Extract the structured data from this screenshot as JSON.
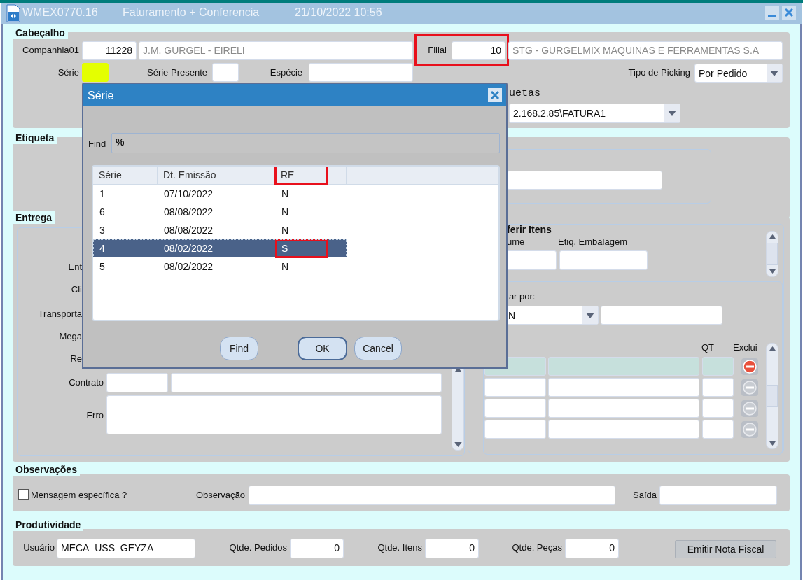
{
  "window": {
    "title_parts": [
      "WMEX0770.16",
      "Faturamento + Conferencia",
      "21/10/2022 10:56"
    ]
  },
  "cabecalho": {
    "title": "Cabeçalho",
    "companhia": {
      "label": "Companhia01",
      "code": "11228",
      "name": "J.M. GURGEL - EIRELI"
    },
    "filial": {
      "label": "Filial",
      "code": "10",
      "name": "STG - GURGELMIX MAQUINAS E FERRAMENTAS S.A",
      "highlighted": true
    },
    "serie": {
      "label": "Série",
      "focused": true
    },
    "serie_presente": {
      "label": "Série Presente"
    },
    "especie": {
      "label": "Espécie"
    },
    "tipo_picking": {
      "label": "Tipo de Picking",
      "value": "Por Pedido"
    },
    "impressora": {
      "label": "uetas",
      "value": "2.168.2.85\\FATURA1"
    }
  },
  "etiqueta": {
    "title": "Etiqueta"
  },
  "entrega": {
    "title": "Entrega",
    "labels": [
      "Ent",
      "Cli",
      "Transporta",
      "Mega",
      "Re"
    ],
    "contrato": {
      "label": "Contrato"
    },
    "erro": {
      "label": "Erro"
    },
    "conferir": {
      "title": "ferir Itens",
      "columns": [
        "ume",
        "Etiq. Embalagem"
      ]
    },
    "filtrar": {
      "label": "lar por:",
      "value": "N"
    },
    "itens": {
      "columns": [
        "QT",
        "Exclui"
      ],
      "rows": [
        {
          "active": true
        },
        {
          "active": false
        },
        {
          "active": false
        },
        {
          "active": false
        }
      ]
    }
  },
  "observacoes": {
    "title": "Observações",
    "checkbox": {
      "label": "Mensagem específica ?",
      "checked": false
    },
    "observacao": {
      "label": "Observação"
    },
    "saida": {
      "label": "Saída"
    }
  },
  "produtividade": {
    "title": "Produtividade",
    "usuario": {
      "label": "Usuário",
      "value": "MECA_USS_GEYZA"
    },
    "counters": [
      {
        "label": "Qtde. Pedidos",
        "value": "0"
      },
      {
        "label": "Qtde. Itens",
        "value": "0"
      },
      {
        "label": "Qtde. Peças",
        "value": "0"
      }
    ],
    "button": "Emitir Nota Fiscal"
  },
  "dialog": {
    "title": "Série",
    "find": {
      "label": "Find",
      "value": "%"
    },
    "columns": [
      {
        "label": "Série",
        "highlighted": false
      },
      {
        "label": "Dt. Emissão",
        "highlighted": false
      },
      {
        "label": "RE",
        "highlighted": true
      }
    ],
    "rows": [
      {
        "cells": [
          "1",
          "07/10/2022",
          "N"
        ],
        "selected": false,
        "highlighted": false
      },
      {
        "cells": [
          "6",
          "08/08/2022",
          "N"
        ],
        "selected": false,
        "highlighted": false
      },
      {
        "cells": [
          "3",
          "08/08/2022",
          "N"
        ],
        "selected": false,
        "highlighted": false
      },
      {
        "cells": [
          "4",
          "08/02/2022",
          "S"
        ],
        "selected": true,
        "highlighted": true
      },
      {
        "cells": [
          "5",
          "08/02/2022",
          "N"
        ],
        "selected": false,
        "highlighted": false
      }
    ],
    "buttons": [
      {
        "label": "Find",
        "default": false
      },
      {
        "label": "OK",
        "default": true
      },
      {
        "label": "Cancel",
        "default": false
      }
    ]
  }
}
